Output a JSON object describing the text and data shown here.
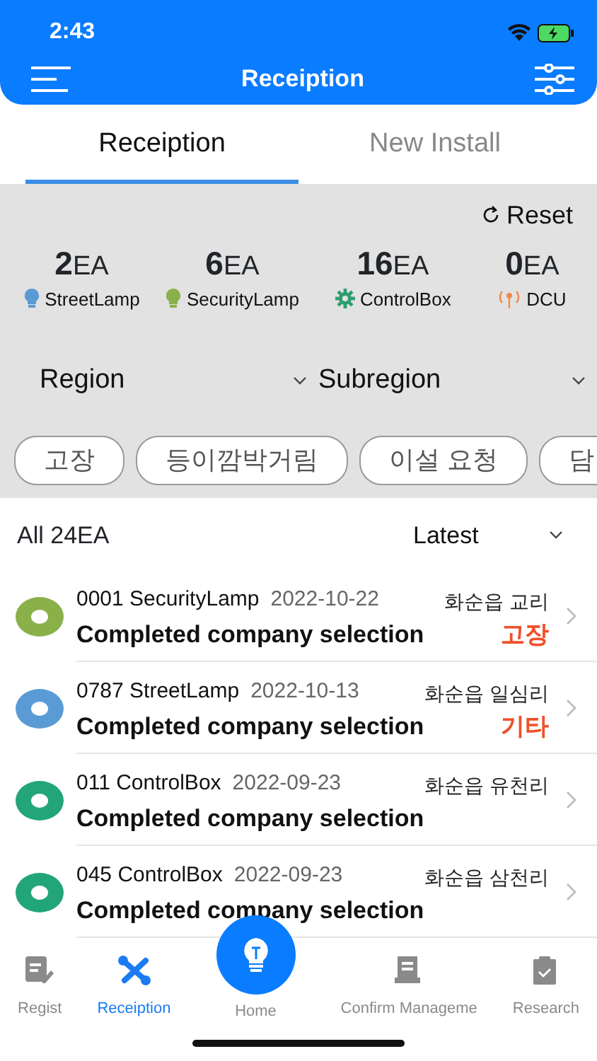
{
  "status_bar": {
    "time": "2:43"
  },
  "header": {
    "title": "Receiption"
  },
  "tabs": [
    {
      "label": "Receiption",
      "selected": true
    },
    {
      "label": "New Install",
      "selected": false
    }
  ],
  "reset": {
    "label": "Reset"
  },
  "summary": [
    {
      "count": "2",
      "unit": "EA",
      "kind": "bulb",
      "color": "#5b9bd5",
      "label": "StreetLamp"
    },
    {
      "count": "6",
      "unit": "EA",
      "kind": "bulb",
      "color": "#8ab04a",
      "label": "SecurityLamp"
    },
    {
      "count": "16",
      "unit": "EA",
      "kind": "gear",
      "color": "#2e9e6e",
      "label": "ControlBox"
    },
    {
      "count": "0",
      "unit": "EA",
      "kind": "antenna",
      "color": "#f08a4b",
      "label": "DCU"
    }
  ],
  "filters": [
    {
      "label": "Region"
    },
    {
      "label": "Subregion"
    }
  ],
  "chips": [
    "고장",
    "등이깜박거림",
    "이설 요청",
    "담"
  ],
  "list_header": {
    "total": "All 24EA",
    "sort": "Latest"
  },
  "items": [
    {
      "color": "#8ab04a",
      "title": "0001 SecurityLamp",
      "date": "2022-10-22",
      "location": "화순읍 교리",
      "status": "Completed company selection",
      "tag": "고장"
    },
    {
      "color": "#5b9bd5",
      "title": "0787 StreetLamp",
      "date": "2022-10-13",
      "location": "화순읍 일심리",
      "status": "Completed company selection",
      "tag": "기타"
    },
    {
      "color": "#23a57a",
      "title": "011 ControlBox",
      "date": "2022-09-23",
      "location": "화순읍 유천리",
      "status": "Completed company selection"
    },
    {
      "color": "#23a57a",
      "title": "045 ControlBox",
      "date": "2022-09-23",
      "location": "화순읍 삼천리",
      "status": "Completed company selection"
    }
  ],
  "nav": [
    {
      "kind": "regist",
      "label": "Regist",
      "selected": false
    },
    {
      "kind": "tools",
      "label": "Receiption",
      "selected": true
    },
    {
      "kind": "home",
      "label": "Home",
      "selected": false
    },
    {
      "kind": "confirm",
      "label": "Confirm Manageme",
      "selected": false
    },
    {
      "kind": "research",
      "label": "Research",
      "selected": false
    }
  ]
}
